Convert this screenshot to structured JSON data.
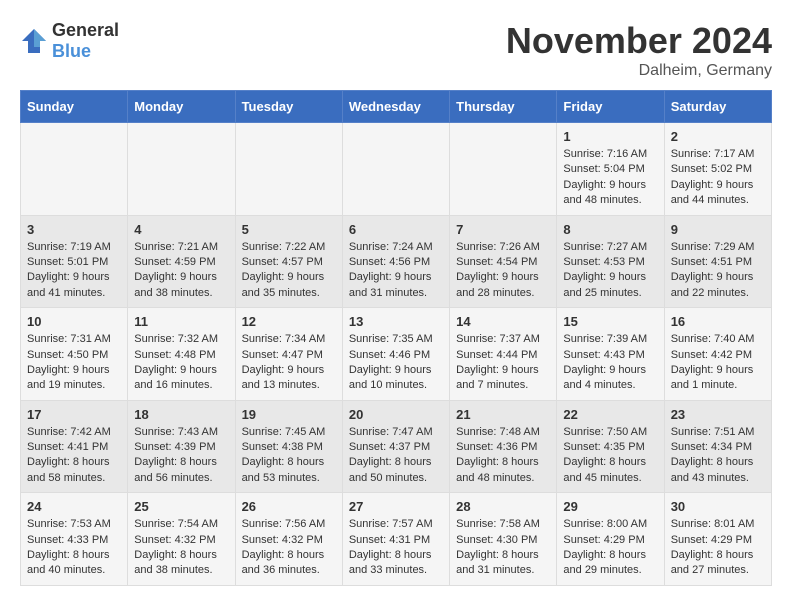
{
  "header": {
    "logo_general": "General",
    "logo_blue": "Blue",
    "title": "November 2024",
    "location": "Dalheim, Germany"
  },
  "weekdays": [
    "Sunday",
    "Monday",
    "Tuesday",
    "Wednesday",
    "Thursday",
    "Friday",
    "Saturday"
  ],
  "weeks": [
    [
      {
        "day": "",
        "info": ""
      },
      {
        "day": "",
        "info": ""
      },
      {
        "day": "",
        "info": ""
      },
      {
        "day": "",
        "info": ""
      },
      {
        "day": "",
        "info": ""
      },
      {
        "day": "1",
        "info": "Sunrise: 7:16 AM\nSunset: 5:04 PM\nDaylight: 9 hours and 48 minutes."
      },
      {
        "day": "2",
        "info": "Sunrise: 7:17 AM\nSunset: 5:02 PM\nDaylight: 9 hours and 44 minutes."
      }
    ],
    [
      {
        "day": "3",
        "info": "Sunrise: 7:19 AM\nSunset: 5:01 PM\nDaylight: 9 hours and 41 minutes."
      },
      {
        "day": "4",
        "info": "Sunrise: 7:21 AM\nSunset: 4:59 PM\nDaylight: 9 hours and 38 minutes."
      },
      {
        "day": "5",
        "info": "Sunrise: 7:22 AM\nSunset: 4:57 PM\nDaylight: 9 hours and 35 minutes."
      },
      {
        "day": "6",
        "info": "Sunrise: 7:24 AM\nSunset: 4:56 PM\nDaylight: 9 hours and 31 minutes."
      },
      {
        "day": "7",
        "info": "Sunrise: 7:26 AM\nSunset: 4:54 PM\nDaylight: 9 hours and 28 minutes."
      },
      {
        "day": "8",
        "info": "Sunrise: 7:27 AM\nSunset: 4:53 PM\nDaylight: 9 hours and 25 minutes."
      },
      {
        "day": "9",
        "info": "Sunrise: 7:29 AM\nSunset: 4:51 PM\nDaylight: 9 hours and 22 minutes."
      }
    ],
    [
      {
        "day": "10",
        "info": "Sunrise: 7:31 AM\nSunset: 4:50 PM\nDaylight: 9 hours and 19 minutes."
      },
      {
        "day": "11",
        "info": "Sunrise: 7:32 AM\nSunset: 4:48 PM\nDaylight: 9 hours and 16 minutes."
      },
      {
        "day": "12",
        "info": "Sunrise: 7:34 AM\nSunset: 4:47 PM\nDaylight: 9 hours and 13 minutes."
      },
      {
        "day": "13",
        "info": "Sunrise: 7:35 AM\nSunset: 4:46 PM\nDaylight: 9 hours and 10 minutes."
      },
      {
        "day": "14",
        "info": "Sunrise: 7:37 AM\nSunset: 4:44 PM\nDaylight: 9 hours and 7 minutes."
      },
      {
        "day": "15",
        "info": "Sunrise: 7:39 AM\nSunset: 4:43 PM\nDaylight: 9 hours and 4 minutes."
      },
      {
        "day": "16",
        "info": "Sunrise: 7:40 AM\nSunset: 4:42 PM\nDaylight: 9 hours and 1 minute."
      }
    ],
    [
      {
        "day": "17",
        "info": "Sunrise: 7:42 AM\nSunset: 4:41 PM\nDaylight: 8 hours and 58 minutes."
      },
      {
        "day": "18",
        "info": "Sunrise: 7:43 AM\nSunset: 4:39 PM\nDaylight: 8 hours and 56 minutes."
      },
      {
        "day": "19",
        "info": "Sunrise: 7:45 AM\nSunset: 4:38 PM\nDaylight: 8 hours and 53 minutes."
      },
      {
        "day": "20",
        "info": "Sunrise: 7:47 AM\nSunset: 4:37 PM\nDaylight: 8 hours and 50 minutes."
      },
      {
        "day": "21",
        "info": "Sunrise: 7:48 AM\nSunset: 4:36 PM\nDaylight: 8 hours and 48 minutes."
      },
      {
        "day": "22",
        "info": "Sunrise: 7:50 AM\nSunset: 4:35 PM\nDaylight: 8 hours and 45 minutes."
      },
      {
        "day": "23",
        "info": "Sunrise: 7:51 AM\nSunset: 4:34 PM\nDaylight: 8 hours and 43 minutes."
      }
    ],
    [
      {
        "day": "24",
        "info": "Sunrise: 7:53 AM\nSunset: 4:33 PM\nDaylight: 8 hours and 40 minutes."
      },
      {
        "day": "25",
        "info": "Sunrise: 7:54 AM\nSunset: 4:32 PM\nDaylight: 8 hours and 38 minutes."
      },
      {
        "day": "26",
        "info": "Sunrise: 7:56 AM\nSunset: 4:32 PM\nDaylight: 8 hours and 36 minutes."
      },
      {
        "day": "27",
        "info": "Sunrise: 7:57 AM\nSunset: 4:31 PM\nDaylight: 8 hours and 33 minutes."
      },
      {
        "day": "28",
        "info": "Sunrise: 7:58 AM\nSunset: 4:30 PM\nDaylight: 8 hours and 31 minutes."
      },
      {
        "day": "29",
        "info": "Sunrise: 8:00 AM\nSunset: 4:29 PM\nDaylight: 8 hours and 29 minutes."
      },
      {
        "day": "30",
        "info": "Sunrise: 8:01 AM\nSunset: 4:29 PM\nDaylight: 8 hours and 27 minutes."
      }
    ]
  ]
}
